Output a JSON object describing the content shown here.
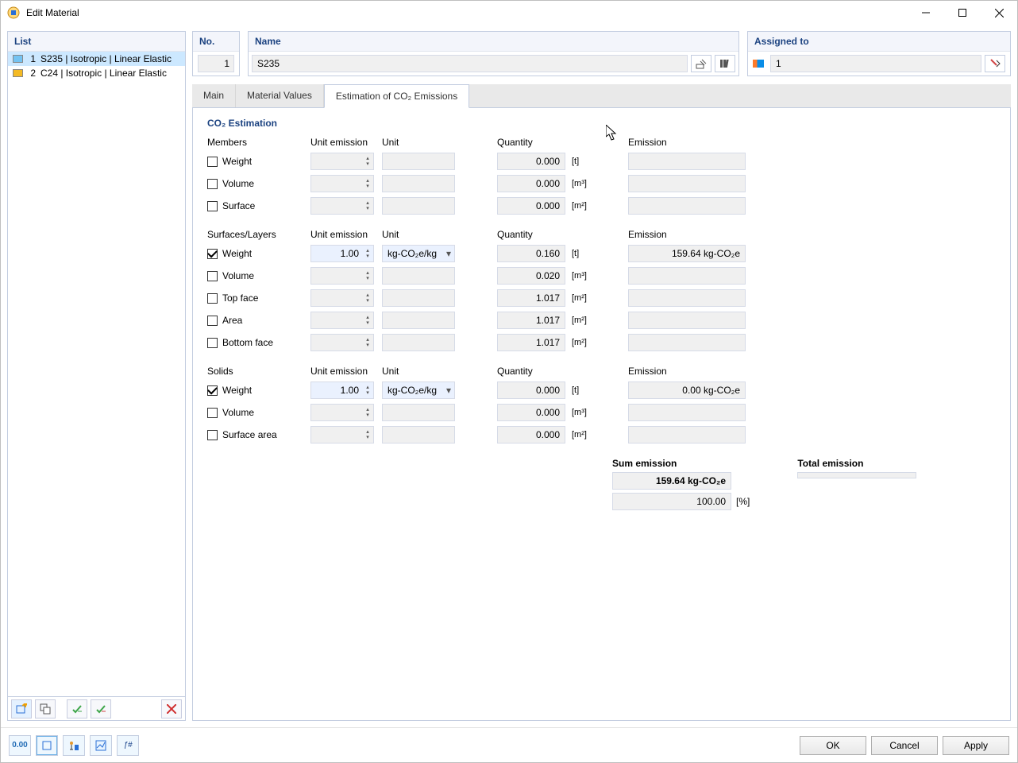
{
  "window": {
    "title": "Edit Material"
  },
  "list": {
    "header": "List",
    "items": [
      {
        "num": "1",
        "label": "S235 | Isotropic | Linear Elastic",
        "color": "#74c3f2",
        "selected": true
      },
      {
        "num": "2",
        "label": "C24 | Isotropic | Linear Elastic",
        "color": "#f4ba24",
        "selected": false
      }
    ]
  },
  "no": {
    "label": "No.",
    "value": "1"
  },
  "name": {
    "label": "Name",
    "value": "S235"
  },
  "assigned": {
    "label": "Assigned to",
    "value": "1"
  },
  "tabs": {
    "main": "Main",
    "values": "Material Values",
    "co2": "Estimation of CO₂ Emissions"
  },
  "section": {
    "title": "CO₂ Estimation"
  },
  "col": {
    "unit_emission": "Unit emission",
    "unit": "Unit",
    "quantity": "Quantity",
    "emission": "Emission"
  },
  "members": {
    "title": "Members",
    "rows": [
      {
        "label": "Weight",
        "checked": false,
        "ue": "",
        "unit": "",
        "qty": "0.000",
        "qunit": "[t]",
        "emis": ""
      },
      {
        "label": "Volume",
        "checked": false,
        "ue": "",
        "unit": "",
        "qty": "0.000",
        "qunit": "[m³]",
        "emis": ""
      },
      {
        "label": "Surface",
        "checked": false,
        "ue": "",
        "unit": "",
        "qty": "0.000",
        "qunit": "[m²]",
        "emis": ""
      }
    ]
  },
  "surfaces": {
    "title": "Surfaces/Layers",
    "rows": [
      {
        "label": "Weight",
        "checked": true,
        "ue": "1.00",
        "unit": "kg-CO₂e/kg",
        "qty": "0.160",
        "qunit": "[t]",
        "emis": "159.64 kg-CO₂e"
      },
      {
        "label": "Volume",
        "checked": false,
        "ue": "",
        "unit": "",
        "qty": "0.020",
        "qunit": "[m³]",
        "emis": ""
      },
      {
        "label": "Top face",
        "checked": false,
        "ue": "",
        "unit": "",
        "qty": "1.017",
        "qunit": "[m²]",
        "emis": ""
      },
      {
        "label": "Area",
        "checked": false,
        "ue": "",
        "unit": "",
        "qty": "1.017",
        "qunit": "[m²]",
        "emis": ""
      },
      {
        "label": "Bottom face",
        "checked": false,
        "ue": "",
        "unit": "",
        "qty": "1.017",
        "qunit": "[m²]",
        "emis": ""
      }
    ]
  },
  "solids": {
    "title": "Solids",
    "rows": [
      {
        "label": "Weight",
        "checked": true,
        "ue": "1.00",
        "unit": "kg-CO₂e/kg",
        "qty": "0.000",
        "qunit": "[t]",
        "emis": "0.00 kg-CO₂e"
      },
      {
        "label": "Volume",
        "checked": false,
        "ue": "",
        "unit": "",
        "qty": "0.000",
        "qunit": "[m³]",
        "emis": ""
      },
      {
        "label": "Surface area",
        "checked": false,
        "ue": "",
        "unit": "",
        "qty": "0.000",
        "qunit": "[m²]",
        "emis": ""
      }
    ]
  },
  "sum": {
    "sum_label": "Sum emission",
    "total_label": "Total emission",
    "sum_value": "159.64 kg-CO₂e",
    "pct_value": "100.00",
    "pct_unit": "[%]",
    "total_value": ""
  },
  "buttons": {
    "ok": "OK",
    "cancel": "Cancel",
    "apply": "Apply"
  },
  "bottom_tools": {
    "t0": "0.00",
    "t4": "ƒ#"
  }
}
